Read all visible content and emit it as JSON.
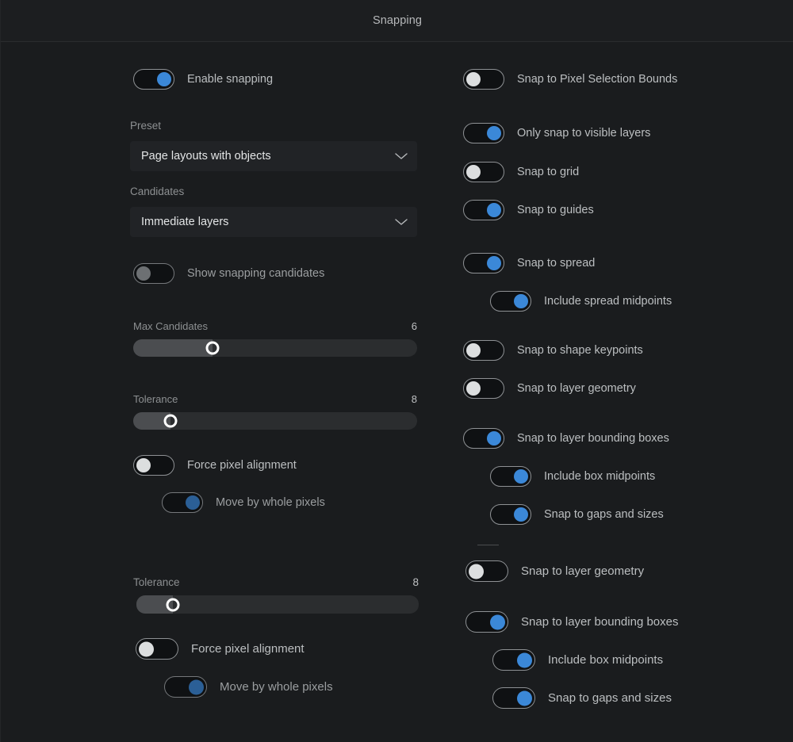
{
  "window": {
    "title": "Snapping"
  },
  "icons": {
    "chevron_down": "chevron-down-icon"
  },
  "colors": {
    "background": "#1a1c1e",
    "titlebar": "#1c1e20",
    "accent_blue": "#3b88d8",
    "accent_blue_dim": "#2b5f96",
    "knob_off": "#dcdedf",
    "knob_disabled": "#6d7073",
    "label_text": "#bcbfc1",
    "muted_text": "#8d9092",
    "field_bg": "#212326",
    "slider_track": "#2b2d2f",
    "slider_fill": "#4b4d50"
  },
  "left_column": {
    "enable_snapping": {
      "label": "Enable snapping",
      "state": "on"
    },
    "preset": {
      "label": "Preset",
      "value": "Page layouts with objects"
    },
    "candidates": {
      "label": "Candidates",
      "value": "Immediate layers"
    },
    "show_snapping_candidates": {
      "label": "Show snapping candidates",
      "state": "disabled-off"
    },
    "max_candidates": {
      "label": "Max Candidates",
      "value": "6",
      "percent": 28
    },
    "tolerance": {
      "label": "Tolerance",
      "value": "8",
      "percent": 13
    },
    "force_pixel_alignment": {
      "label": "Force pixel alignment",
      "state": "off"
    },
    "move_by_whole_pixels": {
      "label": "Move by whole pixels",
      "state": "dim-on"
    },
    "tolerance_2": {
      "label": "Tolerance",
      "value": "8",
      "percent": 13
    },
    "force_pixel_alignment_2": {
      "label": "Force pixel alignment",
      "state": "off"
    },
    "move_by_whole_pixels_2": {
      "label": "Move by whole pixels",
      "state": "dim-on"
    }
  },
  "right_column": {
    "snap_to_pixel_selection_bounds": {
      "label": "Snap to Pixel Selection Bounds",
      "state": "off"
    },
    "only_snap_to_visible_layers": {
      "label": "Only snap to visible layers",
      "state": "on"
    },
    "snap_to_grid": {
      "label": "Snap to grid",
      "state": "off"
    },
    "snap_to_guides": {
      "label": "Snap to guides",
      "state": "on"
    },
    "snap_to_spread": {
      "label": "Snap to spread",
      "state": "on"
    },
    "include_spread_midpoints": {
      "label": "Include spread midpoints",
      "state": "on"
    },
    "snap_to_shape_keypoints": {
      "label": "Snap to shape keypoints",
      "state": "off"
    },
    "snap_to_layer_geometry": {
      "label": "Snap to layer geometry",
      "state": "off"
    },
    "snap_to_layer_bounding_boxes": {
      "label": "Snap to layer bounding boxes",
      "state": "on"
    },
    "include_box_midpoints": {
      "label": "Include box midpoints",
      "state": "on"
    },
    "snap_to_gaps_and_sizes": {
      "label": "Snap to gaps and sizes",
      "state": "on"
    },
    "snap_to_layer_geometry_2": {
      "label": "Snap to layer geometry",
      "state": "off"
    },
    "snap_to_layer_bounding_boxes_2": {
      "label": "Snap to layer bounding boxes",
      "state": "on"
    },
    "include_box_midpoints_2": {
      "label": "Include box midpoints",
      "state": "on"
    },
    "snap_to_gaps_and_sizes_2": {
      "label": "Snap to gaps and sizes",
      "state": "on"
    }
  }
}
